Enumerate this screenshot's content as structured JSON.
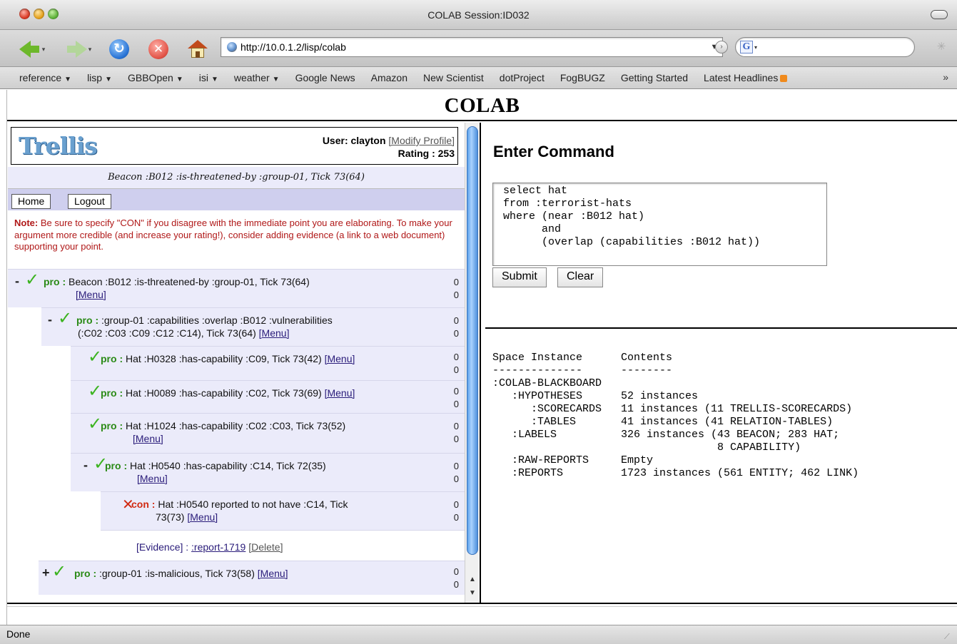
{
  "window": {
    "title": "COLAB Session:ID032"
  },
  "toolbar": {
    "url": "http://10.0.1.2/lisp/colab",
    "search_logo": "G"
  },
  "bookmarks": [
    {
      "label": "reference",
      "menu": true
    },
    {
      "label": "lisp",
      "menu": true
    },
    {
      "label": "GBBOpen",
      "menu": true
    },
    {
      "label": "isi",
      "menu": true
    },
    {
      "label": "weather",
      "menu": true
    },
    {
      "label": "Google News",
      "menu": false
    },
    {
      "label": "Amazon",
      "menu": false
    },
    {
      "label": "New Scientist",
      "menu": false
    },
    {
      "label": "dotProject",
      "menu": false
    },
    {
      "label": "FogBUGZ",
      "menu": false
    },
    {
      "label": "Getting Started",
      "menu": false
    },
    {
      "label": "Latest Headlines",
      "menu": false,
      "rss": true
    }
  ],
  "bookmarks_more": "»",
  "page": {
    "title": "COLAB"
  },
  "trellis": {
    "logo": "Trellis",
    "user_label": "User: clayton",
    "modify_profile": "[Modify Profile]",
    "rating": "Rating : 253",
    "focus": "Beacon :B012 :is-threatened-by :group-01, Tick 73(64)",
    "home_button": "Home",
    "logout_button": "Logout",
    "note_label": "Note:",
    "note_text": " Be sure to specify \"CON\" if you disagree with the immediate point you are elaborating. To make your argument more credible (and increase your rating!), consider adding evidence (a link to a web document) supporting your point."
  },
  "tree": {
    "menu_label": "[Menu]",
    "nodes": [
      {
        "expander": "-",
        "stance": "pro",
        "stance_label": "pro :",
        "text": " Beacon :B012 :is-threatened-by :group-01, Tick 73(64)",
        "pro_count": "0",
        "con_count": "0"
      },
      {
        "expander": "-",
        "stance": "pro",
        "stance_label": "pro :",
        "text": " :group-01 :capabilities :overlap :B012 :vulnerabilities",
        "text2": "(:C02 :C03 :C09 :C12 :C14), Tick 73(64)",
        "pro_count": "0",
        "con_count": "0"
      },
      {
        "expander": "",
        "stance": "pro",
        "stance_label": "pro :",
        "text": " Hat :H0328 :has-capability :C09, Tick 73(42)",
        "pro_count": "0",
        "con_count": "0"
      },
      {
        "expander": "",
        "stance": "pro",
        "stance_label": "pro :",
        "text": " Hat :H0089 :has-capability :C02, Tick 73(69)",
        "pro_count": "0",
        "con_count": "0"
      },
      {
        "expander": "",
        "stance": "pro",
        "stance_label": "pro :",
        "text": " Hat :H1024 :has-capability :C02 :C03, Tick 73(52)",
        "pro_count": "0",
        "con_count": "0"
      },
      {
        "expander": "-",
        "stance": "pro",
        "stance_label": "pro :",
        "text": " Hat :H0540 :has-capability :C14, Tick 72(35)",
        "pro_count": "0",
        "con_count": "0"
      },
      {
        "expander": "",
        "stance": "con",
        "stance_label": "con :",
        "text": " Hat :H0540 reported to not have :C14, Tick",
        "text2": "73(73)",
        "pro_count": "0",
        "con_count": "0"
      },
      {
        "expander": "+",
        "stance": "pro",
        "stance_label": "pro :",
        "text": " :group-01 :is-malicious, Tick 73(58)",
        "pro_count": "0",
        "con_count": "0"
      }
    ],
    "evidence": {
      "label": "[Evidence] :",
      "link": ":report-1719",
      "delete": "[Delete]"
    }
  },
  "command": {
    "title": "Enter Command",
    "text": "select hat\nfrom :terrorist-hats\nwhere (near :B012 hat)\n      and\n      (overlap (capabilities :B012 hat))",
    "submit_label": "Submit",
    "clear_label": "Clear"
  },
  "output": {
    "text": "Space Instance      Contents\n--------------      --------\n:COLAB-BLACKBOARD\n   :HYPOTHESES      52 instances\n      :SCORECARDS   11 instances (11 TRELLIS-SCORECARDS)\n      :TABLES       41 instances (41 RELATION-TABLES)\n   :LABELS          326 instances (43 BEACON; 283 HAT;\n                                   8 CAPABILITY)\n   :RAW-REPORTS     Empty\n   :REPORTS         1723 instances (561 ENTITY; 462 LINK)"
  },
  "status": {
    "text": "Done"
  },
  "colors": {
    "pro": "#2a8a16",
    "con": "#d12a12",
    "check": "#3bb31f",
    "note": "#b01818",
    "focus_bg": "#ebebfa",
    "nav_bg": "#cfcfee"
  }
}
